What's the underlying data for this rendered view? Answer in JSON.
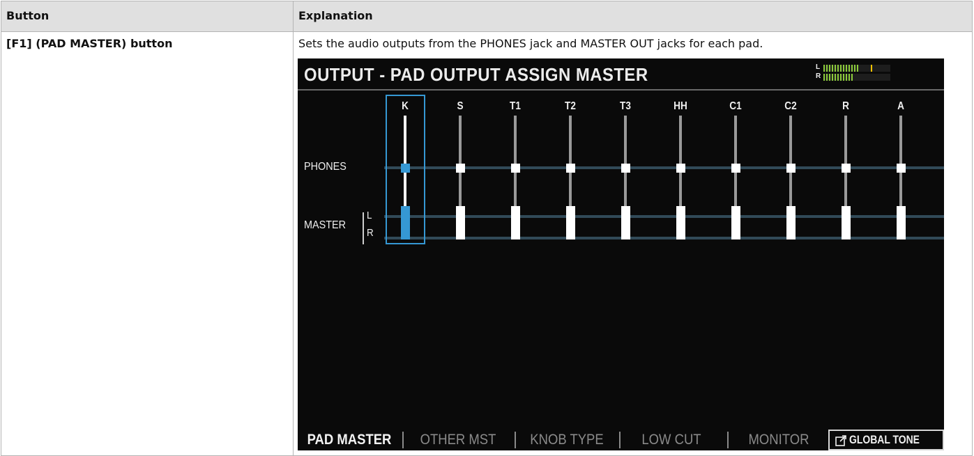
{
  "table": {
    "header": {
      "button": "Button",
      "explanation": "Explanation"
    },
    "row": {
      "button": "[F1] (PAD MASTER) button",
      "explanation": "Sets the audio outputs from the PHONES jack and MASTER OUT jacks for each pad."
    }
  },
  "screen": {
    "title": "OUTPUT - PAD OUTPUT ASSIGN MASTER",
    "meter": {
      "left_label": "L",
      "right_label": "R",
      "left_level": 0.85,
      "right_level": 0.7,
      "peak_color": "#f2c200",
      "level_color": "#8ccb3a"
    },
    "pads": [
      "K",
      "S",
      "T1",
      "T2",
      "T3",
      "HH",
      "C1",
      "C2",
      "R",
      "A"
    ],
    "selected_pad": "K",
    "row_labels": {
      "phones": "PHONES",
      "master": "MASTER",
      "master_l": "L",
      "master_r": "R"
    },
    "tabs": [
      "PAD MASTER",
      "OTHER MST",
      "KNOB TYPE",
      "LOW CUT",
      "MONITOR"
    ],
    "active_tab": "PAD MASTER",
    "global_tone": "GLOBAL TONE",
    "global_tone_icon": "external-link-icon",
    "accent_color": "#3598d4"
  }
}
